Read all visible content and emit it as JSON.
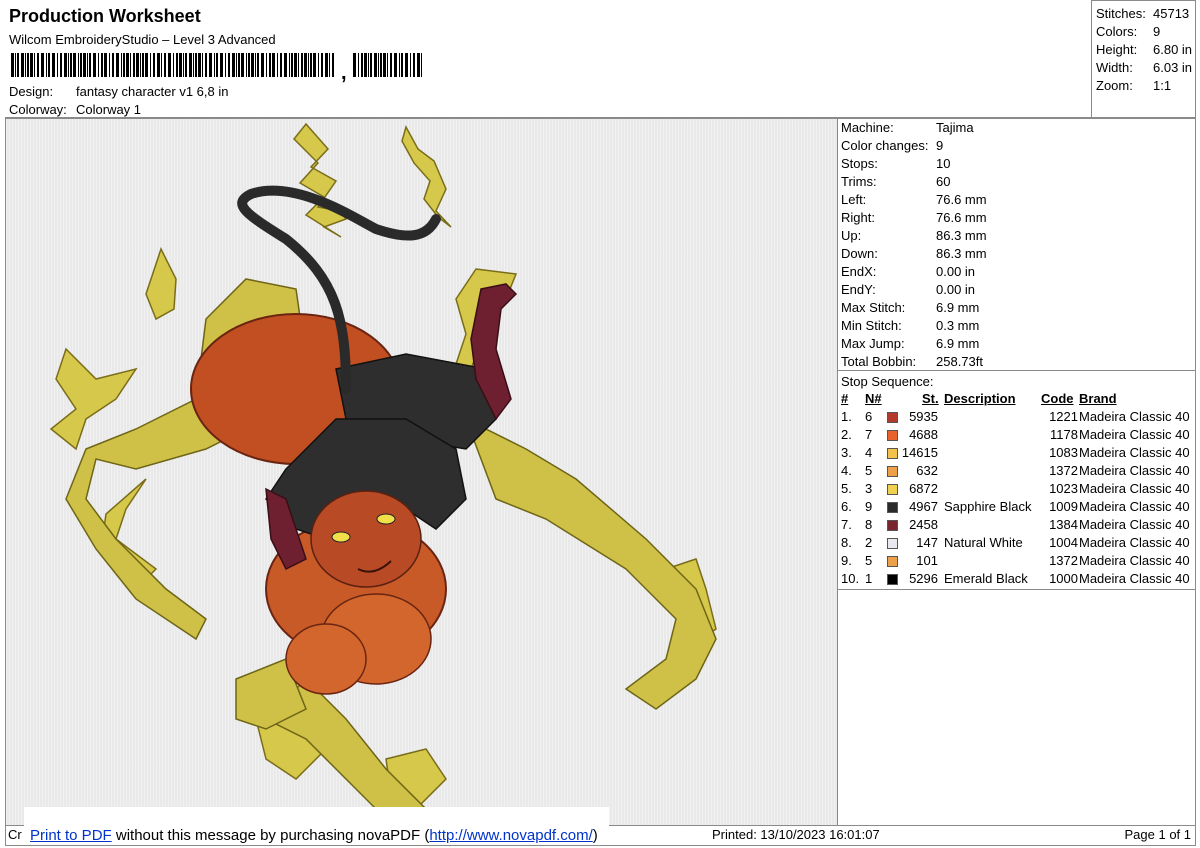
{
  "header": {
    "title": "Production Worksheet",
    "software": "Wilcom EmbroideryStudio – Level 3 Advanced",
    "barcode_suffix": ",",
    "design_label": "Design:",
    "design_value": "fantasy character v1 6,8 in",
    "colorway_label": "Colorway:",
    "colorway_value": "Colorway 1"
  },
  "summary": {
    "rows": [
      {
        "label": "Stitches:",
        "value": "45713"
      },
      {
        "label": "Colors:",
        "value": "9"
      },
      {
        "label": "Height:",
        "value": "6.80 in"
      },
      {
        "label": "Width:",
        "value": "6.03 in"
      },
      {
        "label": "Zoom:",
        "value": "1:1"
      }
    ]
  },
  "machine_info": [
    {
      "label": "Machine:",
      "value": "Tajima"
    },
    {
      "label": "Color changes:",
      "value": "9"
    },
    {
      "label": "Stops:",
      "value": "10"
    },
    {
      "label": "Trims:",
      "value": "60"
    },
    {
      "label": "Left:",
      "value": "76.6 mm"
    },
    {
      "label": "Right:",
      "value": "76.6 mm"
    },
    {
      "label": "Up:",
      "value": "86.3 mm"
    },
    {
      "label": "Down:",
      "value": "86.3 mm"
    },
    {
      "label": "EndX:",
      "value": "0.00 in"
    },
    {
      "label": "EndY:",
      "value": "0.00 in"
    },
    {
      "label": "Max Stitch:",
      "value": "6.9 mm"
    },
    {
      "label": "Min Stitch:",
      "value": "0.3 mm"
    },
    {
      "label": "Max Jump:",
      "value": "6.9 mm"
    },
    {
      "label": "Total Bobbin:",
      "value": "258.73ft"
    }
  ],
  "stop_sequence": {
    "title": "Stop Sequence:",
    "headers": {
      "num": "#",
      "n": "N#",
      "st": "St.",
      "desc": "Description",
      "code": "Code",
      "brand": "Brand"
    },
    "rows": [
      {
        "num": "1.",
        "n": "6",
        "color": "#b5392a",
        "st": "5935",
        "desc": "",
        "code": "1221",
        "brand": "Madeira Classic 40"
      },
      {
        "num": "2.",
        "n": "7",
        "color": "#e8622a",
        "st": "4688",
        "desc": "",
        "code": "1178",
        "brand": "Madeira Classic 40"
      },
      {
        "num": "3.",
        "n": "4",
        "color": "#f3c24a",
        "st": "14615",
        "desc": "",
        "code": "1083",
        "brand": "Madeira Classic 40"
      },
      {
        "num": "4.",
        "n": "5",
        "color": "#eda04a",
        "st": "632",
        "desc": "",
        "code": "1372",
        "brand": "Madeira Classic 40"
      },
      {
        "num": "5.",
        "n": "3",
        "color": "#f0d050",
        "st": "6872",
        "desc": "",
        "code": "1023",
        "brand": "Madeira Classic 40"
      },
      {
        "num": "6.",
        "n": "9",
        "color": "#2a2a2a",
        "st": "4967",
        "desc": "Sapphire Black",
        "code": "1009",
        "brand": "Madeira Classic 40"
      },
      {
        "num": "7.",
        "n": "8",
        "color": "#7a2430",
        "st": "2458",
        "desc": "",
        "code": "1384",
        "brand": "Madeira Classic 40"
      },
      {
        "num": "8.",
        "n": "2",
        "color": "#e8e8ee",
        "st": "147",
        "desc": "Natural White",
        "code": "1004",
        "brand": "Madeira Classic 40"
      },
      {
        "num": "9.",
        "n": "5",
        "color": "#eda04a",
        "st": "101",
        "desc": "",
        "code": "1372",
        "brand": "Madeira Classic 40"
      },
      {
        "num": "10.",
        "n": "1",
        "color": "#000000",
        "st": "5296",
        "desc": "Emerald Black",
        "code": "1000",
        "brand": "Madeira Classic 40"
      }
    ]
  },
  "footer": {
    "cr": "Cr",
    "link_label": "Print to PDF",
    "message_mid": " without this message by purchasing novaPDF (",
    "url": "http://www.novapdf.com/",
    "message_end": ")",
    "printed": "Printed: 13/10/2023 16:01:07",
    "page": "Page 1 of 1"
  }
}
